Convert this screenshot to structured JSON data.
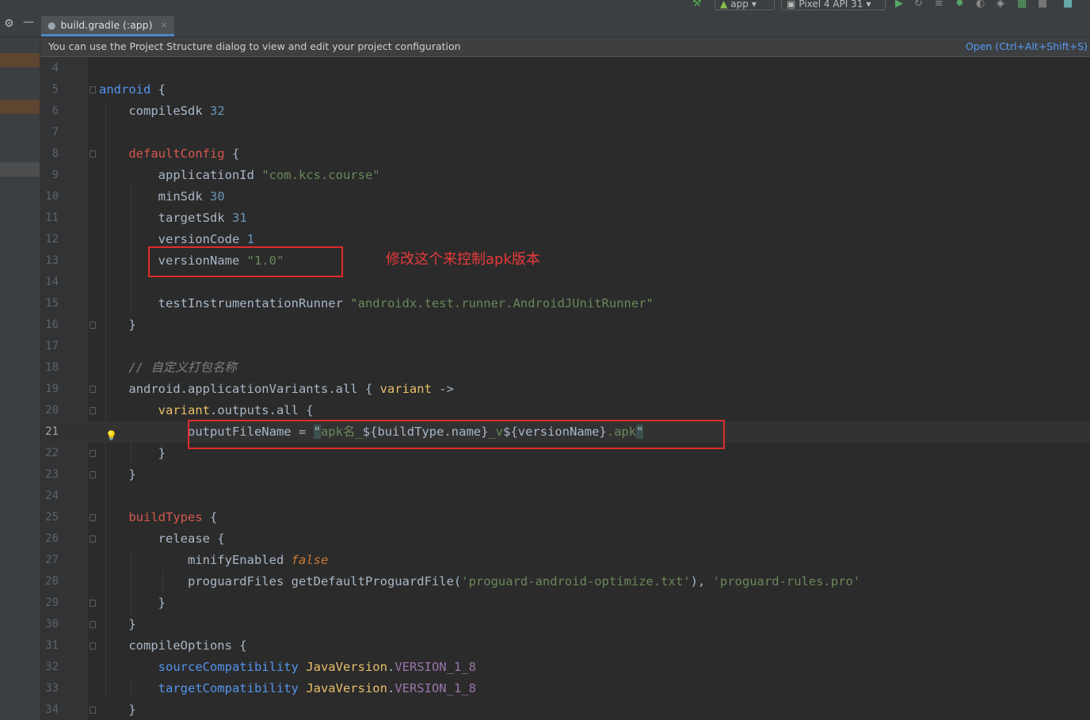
{
  "toolbar": {
    "run_config": "app",
    "device": "Pixel 4 API 31"
  },
  "tabs": [
    {
      "label": "build.gradle (:app)",
      "close": "×"
    }
  ],
  "banner": {
    "message": "You can use the Project Structure dialog to view and edit your project configuration",
    "link": "Open (Ctrl+Alt+Shift+S)"
  },
  "annotation": {
    "note": "修改这个来控制apk版本"
  },
  "code_lines": [
    {
      "n": "4",
      "text": ""
    },
    {
      "n": "5",
      "text": "android {"
    },
    {
      "n": "6",
      "text": "    compileSdk 32"
    },
    {
      "n": "7",
      "text": ""
    },
    {
      "n": "8",
      "text": "    defaultConfig {"
    },
    {
      "n": "9",
      "text": "        applicationId \"com.kcs.course\""
    },
    {
      "n": "10",
      "text": "        minSdk 30"
    },
    {
      "n": "11",
      "text": "        targetSdk 31"
    },
    {
      "n": "12",
      "text": "        versionCode 1"
    },
    {
      "n": "13",
      "text": "        versionName \"1.0\""
    },
    {
      "n": "14",
      "text": ""
    },
    {
      "n": "15",
      "text": "        testInstrumentationRunner \"androidx.test.runner.AndroidJUnitRunner\""
    },
    {
      "n": "16",
      "text": "    }"
    },
    {
      "n": "17",
      "text": ""
    },
    {
      "n": "18",
      "text": "    // 自定义打包名称"
    },
    {
      "n": "19",
      "text": "    android.applicationVariants.all { variant ->"
    },
    {
      "n": "20",
      "text": "        variant.outputs.all {"
    },
    {
      "n": "21",
      "text": "            outputFileName = \"apk名_${buildType.name}_v${versionName}.apk\""
    },
    {
      "n": "22",
      "text": "        }"
    },
    {
      "n": "23",
      "text": "    }"
    },
    {
      "n": "24",
      "text": ""
    },
    {
      "n": "25",
      "text": "    buildTypes {"
    },
    {
      "n": "26",
      "text": "        release {"
    },
    {
      "n": "27",
      "text": "            minifyEnabled false"
    },
    {
      "n": "28",
      "text": "            proguardFiles getDefaultProguardFile('proguard-android-optimize.txt'), 'proguard-rules.pro'"
    },
    {
      "n": "29",
      "text": "        }"
    },
    {
      "n": "30",
      "text": "    }"
    },
    {
      "n": "31",
      "text": "    compileOptions {"
    },
    {
      "n": "32",
      "text": "        sourceCompatibility JavaVersion.VERSION_1_8"
    },
    {
      "n": "33",
      "text": "        targetCompatibility JavaVersion.VERSION_1_8"
    },
    {
      "n": "34",
      "text": "    }"
    }
  ],
  "current_line": "21",
  "colors": {
    "keyword": "#cc7832",
    "number": "#6897bb",
    "string": "#6a8759",
    "comment": "#808080",
    "annotation_red": "#e02b2b",
    "link_blue": "#589df6"
  }
}
